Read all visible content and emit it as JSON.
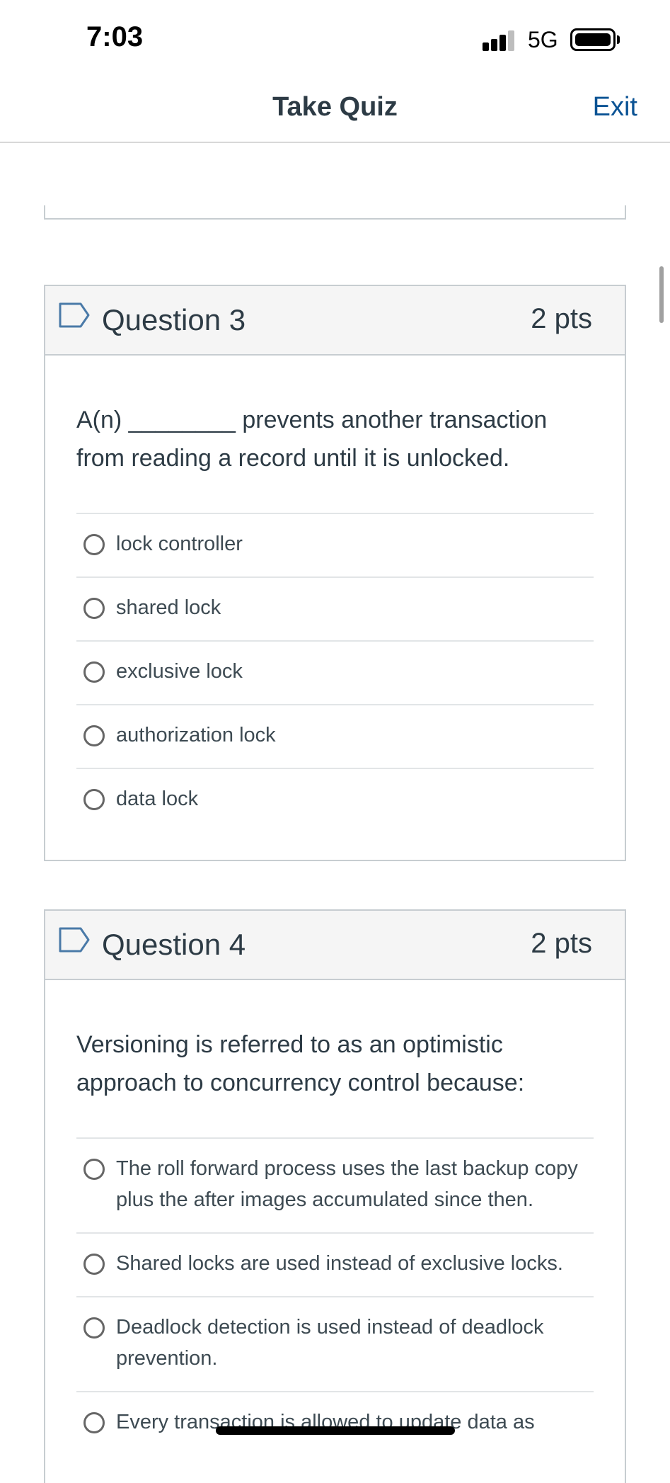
{
  "status_bar": {
    "time": "7:03",
    "network": "5G",
    "icons": [
      "signal-icon",
      "battery-icon"
    ]
  },
  "nav": {
    "title": "Take Quiz",
    "exit_label": "Exit"
  },
  "questions": [
    {
      "title": "Question 3",
      "points": "2 pts",
      "text": "A(n) ________ prevents another transaction from reading a record until it is unlocked.",
      "answers": [
        "lock controller",
        "shared lock",
        "exclusive lock",
        "authorization lock",
        "data lock"
      ]
    },
    {
      "title": "Question 4",
      "points": "2 pts",
      "text": "Versioning is referred to as an optimistic approach to concurrency control because:",
      "answers": [
        "The roll forward process uses the last backup copy plus the after images accumulated since then.",
        "Shared locks are used instead of exclusive locks.",
        "Deadlock detection is used instead of deadlock prevention.",
        "Every transaction is allowed to update data as"
      ]
    }
  ],
  "colors": {
    "text": "#2d3b45",
    "link": "#0b5394",
    "border": "#c7cdd1",
    "header_bg": "#f5f5f5",
    "flag": "#4a7aa8"
  }
}
